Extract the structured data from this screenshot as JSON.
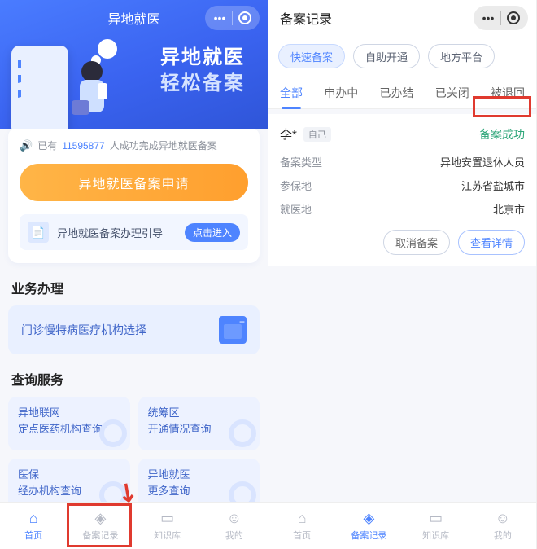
{
  "left": {
    "title": "异地就医",
    "hero_line1": "异地就医",
    "hero_line2": "轻松备案",
    "success_prefix": "已有",
    "success_count": "11595877",
    "success_suffix": "人成功完成异地就医备案",
    "apply_label": "异地就医备案申请",
    "guide_text": "异地就医备案办理引导",
    "guide_btn": "点击进入",
    "section_biz": "业务办理",
    "tile_wide": "门诊慢特病医疗机构选择",
    "section_query": "查询服务",
    "tiles": [
      {
        "l1": "异地联网",
        "l2": "定点医药机构查询"
      },
      {
        "l1": "统筹区",
        "l2": "开通情况查询"
      },
      {
        "l1": "医保",
        "l2": "经办机构查询"
      },
      {
        "l1": "异地就医",
        "l2": "更多查询"
      }
    ],
    "tabs": [
      {
        "label": "首页",
        "active": true
      },
      {
        "label": "备案记录",
        "active": false
      },
      {
        "label": "知识库",
        "active": false
      },
      {
        "label": "我的",
        "active": false
      }
    ]
  },
  "right": {
    "title": "备案记录",
    "filters": [
      {
        "label": "快速备案",
        "active": true
      },
      {
        "label": "自助开通",
        "active": false
      },
      {
        "label": "地方平台",
        "active": false
      }
    ],
    "tabs": [
      "全部",
      "申办中",
      "已办结",
      "已关闭",
      "被退回"
    ],
    "active_tab": "全部",
    "record": {
      "name": "李*",
      "self_tag": "自己",
      "status": "备案成功",
      "fields": [
        {
          "k": "备案类型",
          "v": "异地安置退休人员"
        },
        {
          "k": "参保地",
          "v": "江苏省盐城市"
        },
        {
          "k": "就医地",
          "v": "北京市"
        }
      ],
      "cancel_label": "取消备案",
      "detail_label": "查看详情"
    },
    "tabs_bottom": [
      {
        "label": "首页",
        "active": false
      },
      {
        "label": "备案记录",
        "active": true
      },
      {
        "label": "知识库",
        "active": false
      },
      {
        "label": "我的",
        "active": false
      }
    ]
  }
}
